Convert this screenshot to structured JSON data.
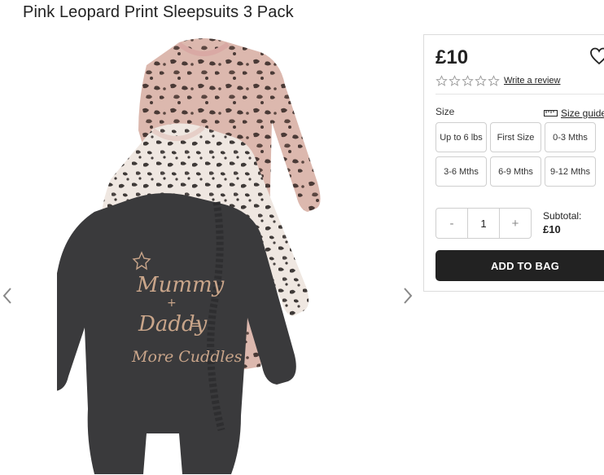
{
  "product": {
    "title": "Pink Leopard Print Sleepsuits 3 Pack",
    "price": "£10",
    "rating": 0,
    "review_link": "Write a review"
  },
  "gallery": {
    "prev_icon": "chevron-left-icon",
    "next_icon": "chevron-right-icon",
    "print_colors": {
      "pink": "#dcb8ae",
      "cream": "#efe7e1",
      "charcoal": "#3a3a3c",
      "print_text": "#c9a58a"
    },
    "garment_print": {
      "line1": "Mummy",
      "line2": "+",
      "line3": "Daddy",
      "line4": "=",
      "line5": "More Cuddles"
    }
  },
  "size": {
    "label": "Size",
    "guide_label": "Size guide",
    "options": [
      "Up to 6 lbs",
      "First Size",
      "0-3 Mths",
      "3-6 Mths",
      "6-9 Mths",
      "9-12 Mths"
    ]
  },
  "quantity": {
    "minus": "-",
    "value": "1",
    "plus": "+"
  },
  "subtotal": {
    "label": "Subtotal:",
    "value": "£10"
  },
  "cta": {
    "add_to_bag": "ADD TO BAG",
    "color": "#222222"
  },
  "icons": {
    "wishlist": "heart-icon",
    "star": "star-outline-icon",
    "size_guide": "ruler-icon"
  }
}
